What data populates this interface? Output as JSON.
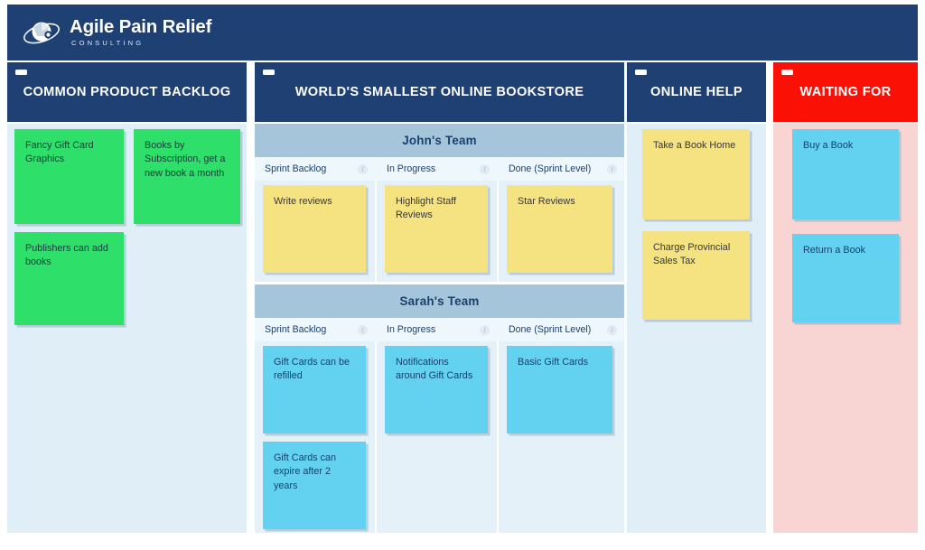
{
  "brand": {
    "title": "Agile Pain Relief",
    "subtitle": "CONSULTING",
    "logo_icon": "globe-orbit-logo",
    "bar_color": "#1f4072"
  },
  "board": {
    "minimize_icon": "minimize-icon",
    "info_icon": "info-icon",
    "columns": [
      {
        "id": "common-product-backlog",
        "title": "COMMON PRODUCT BACKLOG",
        "header_color": "#1f4072",
        "body_color": "#e0eef8",
        "cards": [
          {
            "text": "Fancy Gift Card Graphics",
            "color": "green"
          },
          {
            "text": "Books by Subscription, get a new book a month",
            "color": "green"
          },
          {
            "text": "Publishers can add books",
            "color": "green"
          }
        ]
      },
      {
        "id": "worlds-smallest-online-bookstore",
        "title": "WORLD'S SMALLEST ONLINE BOOKSTORE",
        "header_color": "#1f4072",
        "body_color": "#e4f1f9",
        "swimlanes": [
          {
            "name": "John's Team",
            "sub_columns": [
              {
                "label": "Sprint Backlog",
                "cards": [
                  {
                    "text": "Write reviews",
                    "color": "yellow"
                  }
                ]
              },
              {
                "label": "In Progress",
                "cards": [
                  {
                    "text": "Highlight Staff Reviews",
                    "color": "yellow"
                  }
                ]
              },
              {
                "label": "Done (Sprint Level)",
                "cards": [
                  {
                    "text": "Star Reviews",
                    "color": "yellow"
                  }
                ]
              }
            ]
          },
          {
            "name": "Sarah's Team",
            "sub_columns": [
              {
                "label": "Sprint Backlog",
                "cards": [
                  {
                    "text": "Gift Cards can be refilled",
                    "color": "cyan"
                  },
                  {
                    "text": "Gift Cards can expire after 2 years",
                    "color": "cyan"
                  }
                ]
              },
              {
                "label": "In Progress",
                "cards": [
                  {
                    "text": "Notifications around Gift Cards",
                    "color": "cyan"
                  }
                ]
              },
              {
                "label": "Done (Sprint Level)",
                "cards": [
                  {
                    "text": "Basic Gift Cards",
                    "color": "cyan"
                  }
                ]
              }
            ]
          }
        ]
      },
      {
        "id": "online-help",
        "title": "ONLINE HELP",
        "header_color": "#1f4072",
        "body_color": "#e0eef8",
        "cards": [
          {
            "text": "Take a Book Home",
            "color": "yellow"
          },
          {
            "text": "Charge Provincial Sales Tax",
            "color": "yellow"
          }
        ]
      },
      {
        "id": "waiting-for",
        "title": "WAITING FOR",
        "header_color": "#fa1005",
        "body_color": "#f8d5d3",
        "cards": [
          {
            "text": "Buy a Book",
            "color": "cyan"
          },
          {
            "text": "Return a Book",
            "color": "cyan"
          }
        ]
      }
    ]
  }
}
